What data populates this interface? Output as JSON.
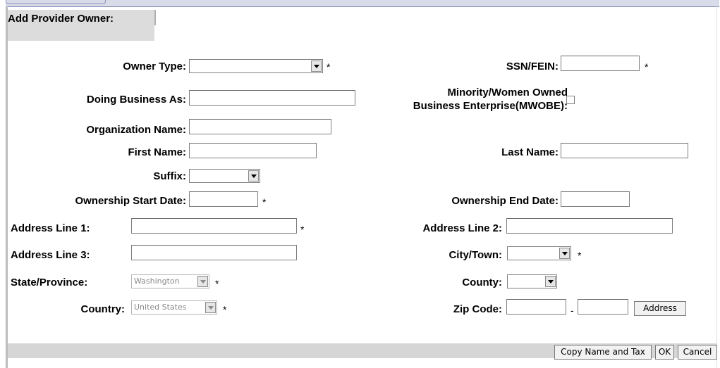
{
  "form": {
    "title": "Add Provider Owner:",
    "owner_type": {
      "label": "Owner Type:",
      "value": "",
      "required": "*"
    },
    "ssn_fein": {
      "label": "SSN/FEIN:",
      "value": "",
      "required": "*"
    },
    "doing_business_as": {
      "label": "Doing Business As:",
      "value": ""
    },
    "mwobe": {
      "label_line1": "Minority/Women Owned",
      "label_line2": "Business Enterprise(MWOBE):",
      "checked": false
    },
    "organization_name": {
      "label": "Organization Name:",
      "value": ""
    },
    "first_name": {
      "label": "First Name:",
      "value": ""
    },
    "last_name": {
      "label": "Last Name:",
      "value": ""
    },
    "suffix": {
      "label": "Suffix:",
      "value": ""
    },
    "ownership_start_date": {
      "label": "Ownership Start Date:",
      "value": "",
      "required": "*"
    },
    "ownership_end_date": {
      "label": "Ownership End Date:",
      "value": ""
    },
    "address_line_1": {
      "label": "Address Line 1:",
      "value": "",
      "required": "*"
    },
    "address_line_2": {
      "label": "Address Line 2:",
      "value": ""
    },
    "address_line_3": {
      "label": "Address Line 3:",
      "value": ""
    },
    "city_town": {
      "label": "City/Town:",
      "value": "",
      "required": "*"
    },
    "state_province": {
      "label": "State/Province:",
      "value": "Washington",
      "required": "*"
    },
    "county": {
      "label": "County:",
      "value": ""
    },
    "country": {
      "label": "Country:",
      "value": "United States",
      "required": "*"
    },
    "zip_code": {
      "label": "Zip Code:",
      "value1": "",
      "separator": "-",
      "value2": "",
      "address_button": "Address"
    }
  },
  "footer": {
    "copy_name_and_tax": "Copy Name and Tax",
    "ok": "OK",
    "cancel": "Cancel"
  }
}
